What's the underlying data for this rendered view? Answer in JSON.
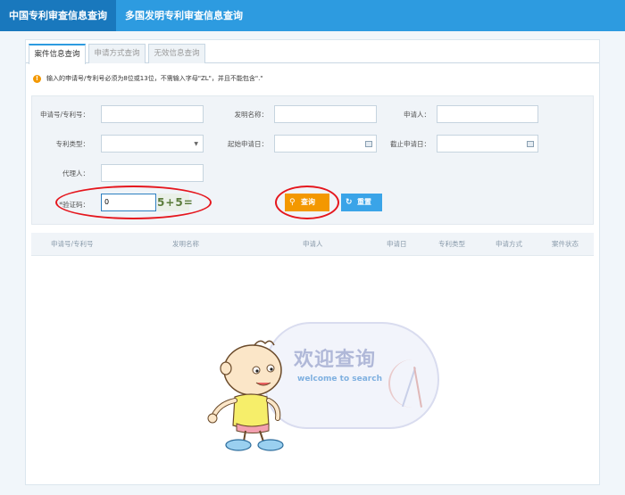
{
  "topnav": {
    "tab1": "中国专利审查信息查询",
    "tab2": "多国发明专利审查信息查询"
  },
  "subtabs": {
    "case": "案件信息查询",
    "apply_method": "申请方式查询",
    "invalid": "无效信息查询"
  },
  "notice": "输入的申请号/专利号必须为8位或13位，不需输入字母\"ZL\"，并且不能包含\".\"",
  "form": {
    "app_no_label": "申请号/专利号：",
    "invention_name_label": "发明名称：",
    "applicant_label": "申请人：",
    "patent_type_label": "专利类型：",
    "start_date_label": "起始申请日：",
    "end_date_label": "截止申请日：",
    "agent_label": "代理人：",
    "captcha_label": "*验证码：",
    "captcha_value": "0",
    "captcha_image_text": "5+5=",
    "search_button": "查询",
    "reset_button": "重置"
  },
  "table": {
    "headers": [
      "申请号/专利号",
      "发明名称",
      "申请人",
      "申请日",
      "专利类型",
      "申请方式",
      "案件状态"
    ]
  },
  "welcome": {
    "cn": "欢迎查询",
    "en": "welcome to search"
  },
  "colors": {
    "topbar": "#2d9be0",
    "topbar_active": "#1978bd",
    "search_button": "#f39800",
    "reset_button": "#3aa4e8",
    "highlight": "#e5161d"
  }
}
